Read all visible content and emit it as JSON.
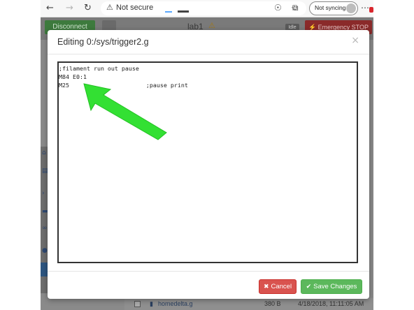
{
  "browser": {
    "back_icon": "←",
    "forward_icon": "→",
    "reload_icon": "↻",
    "warning_icon": "⚠",
    "security_label": "Not secure",
    "favorite_icon": "☆",
    "collections_icon": "☉",
    "split_icon": "⧉",
    "sync_label": "Not syncing",
    "more_icon": "⋯"
  },
  "app": {
    "disconnect_label": "Disconnect",
    "machine_name": "lab1",
    "status_label": "Idle",
    "emergency_label": "⚡ Emergency STOP",
    "file_row": {
      "name": "homedelta.g",
      "size": "380 B",
      "date": "4/18/2018, 11:11:05 AM"
    }
  },
  "modal": {
    "title": "Editing 0:/sys/trigger2.g",
    "close_glyph": "×",
    "editor_lines": [
      ";filament run out pause",
      "M84 E0:1",
      "M25                      ;pause print"
    ],
    "cancel_label": "Cancel",
    "cancel_icon": "✖",
    "save_label": "Save Changes",
    "save_icon": "✔"
  },
  "colors": {
    "cancel": "#d9534f",
    "save": "#5cb85c",
    "annotation_arrow": "#33e033"
  }
}
